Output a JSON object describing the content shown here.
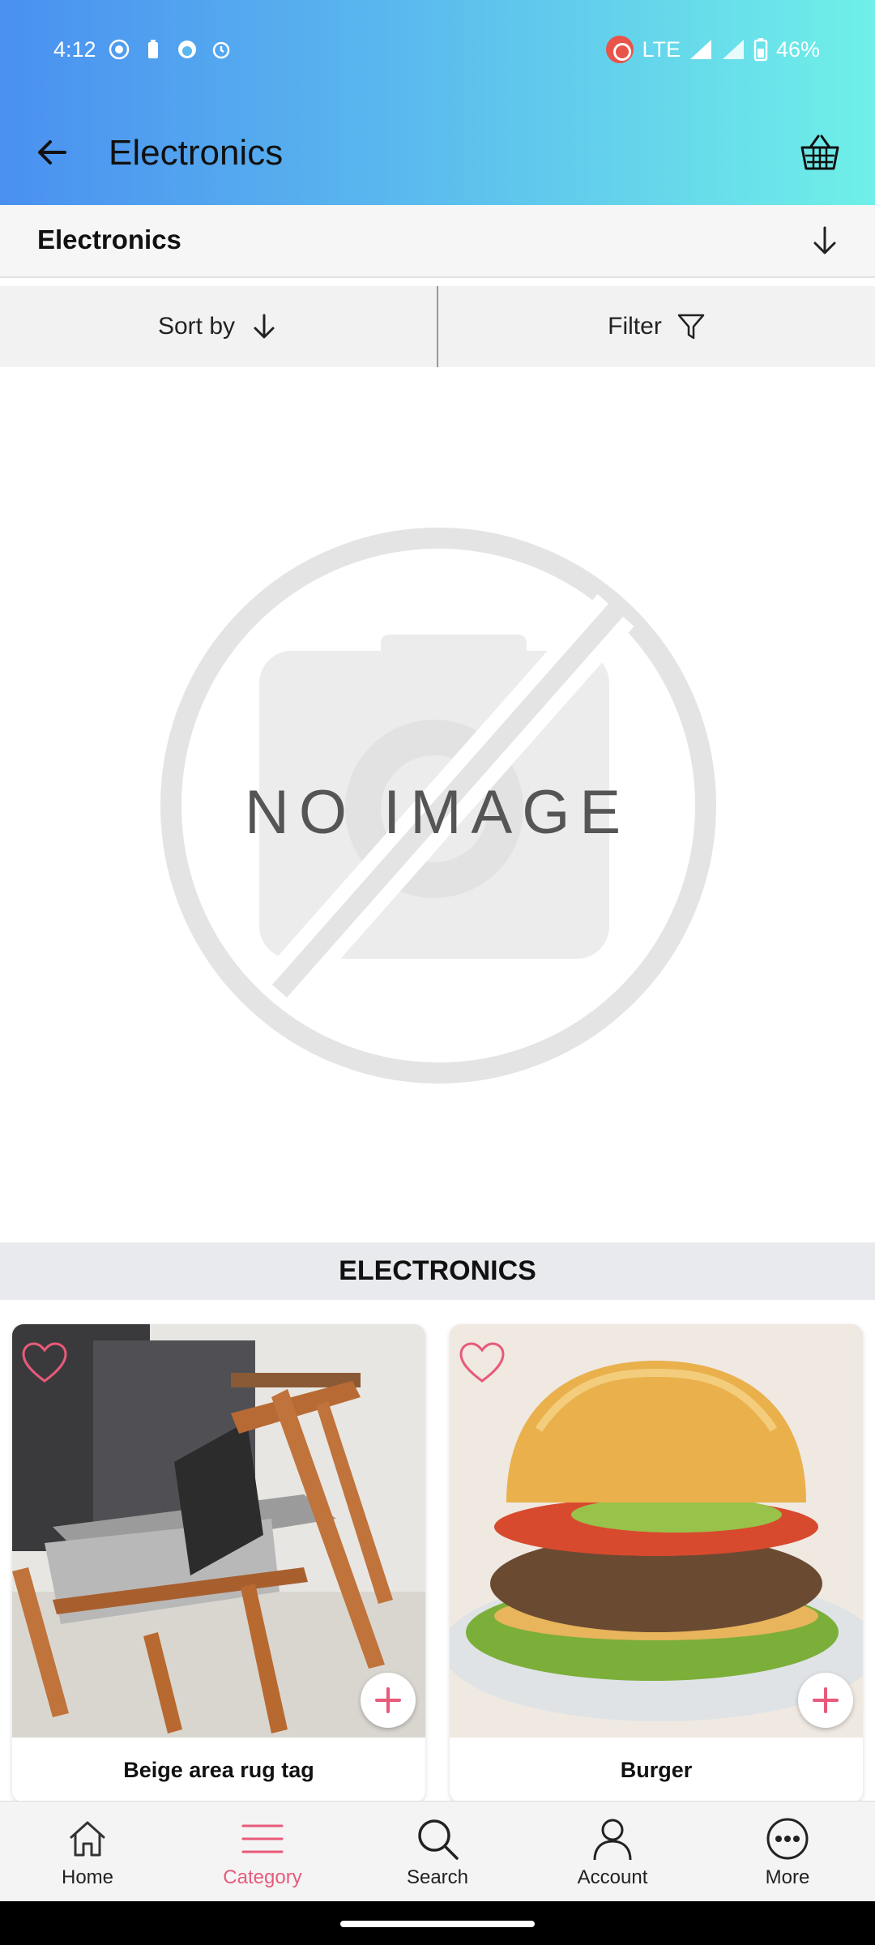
{
  "status_bar": {
    "time": "4:12",
    "network": "LTE",
    "battery": "46%",
    "icons": [
      "record-icon",
      "battery-saver-icon",
      "face-icon",
      "alarm-icon"
    ]
  },
  "app_bar": {
    "title": "Electronics",
    "back_icon": "arrow-left-icon",
    "cart_icon": "basket-icon"
  },
  "category_dropdown": {
    "selected": "Electronics"
  },
  "sort_filter": {
    "sort_label": "Sort by",
    "filter_label": "Filter"
  },
  "banner": {
    "placeholder_text": "NO IMAGE"
  },
  "section": {
    "title": "ELECTRONICS"
  },
  "products": [
    {
      "name": "Beige area rug tag"
    },
    {
      "name": "Burger"
    }
  ],
  "bottom_nav": {
    "items": [
      {
        "label": "Home",
        "icon": "home-icon"
      },
      {
        "label": "Category",
        "icon": "menu-icon"
      },
      {
        "label": "Search",
        "icon": "search-icon"
      },
      {
        "label": "Account",
        "icon": "person-icon"
      },
      {
        "label": "More",
        "icon": "more-icon"
      }
    ],
    "active": "Category"
  },
  "colors": {
    "accent": "#e85a7a",
    "header_start": "#4a90f0",
    "header_end": "#6ff0e8"
  }
}
